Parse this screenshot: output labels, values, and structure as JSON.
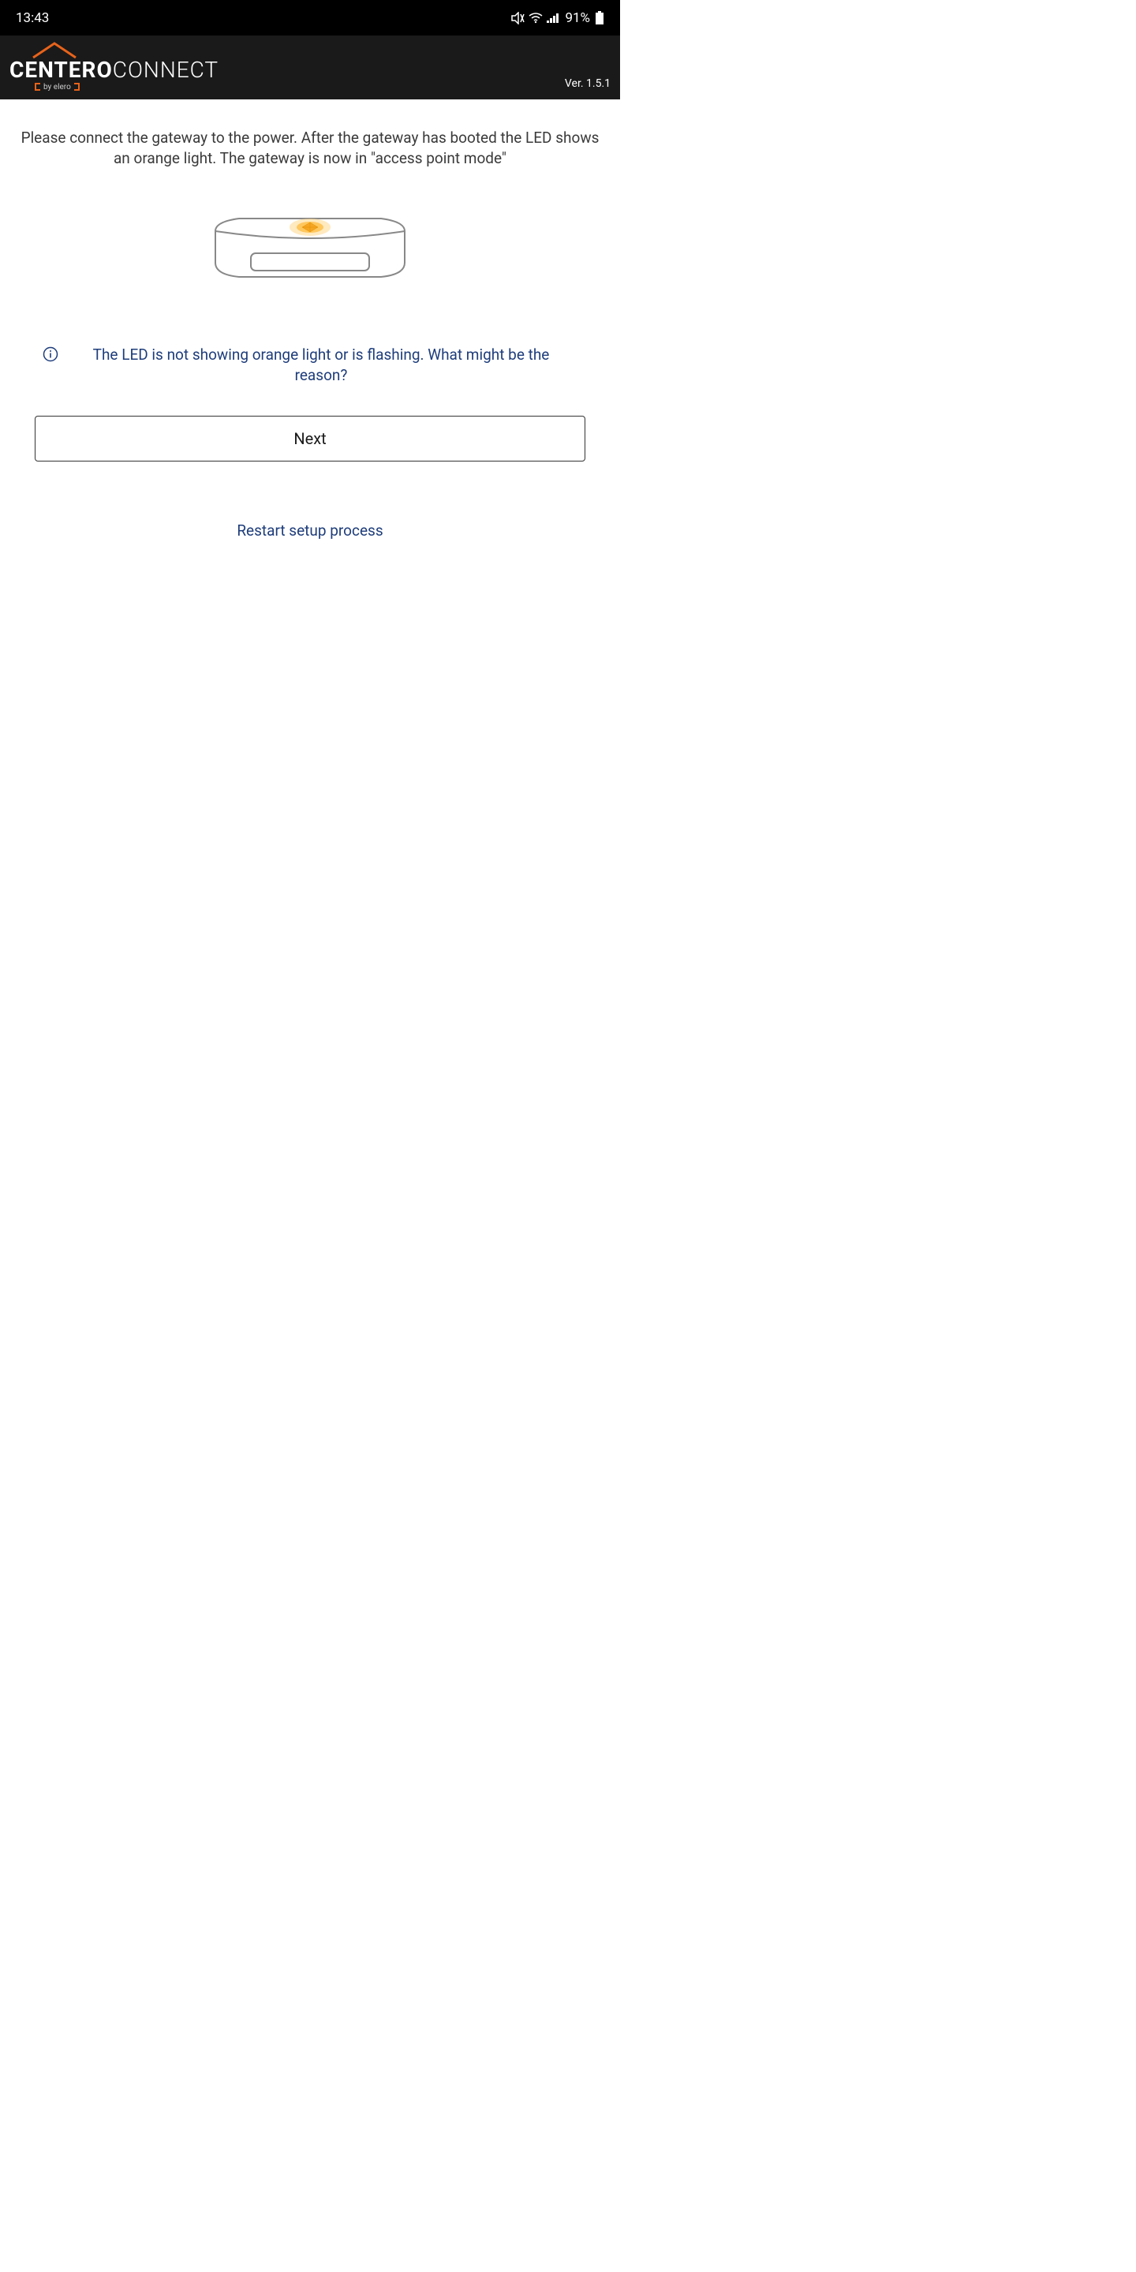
{
  "statusBar": {
    "time": "13:43",
    "battery": "91%"
  },
  "header": {
    "logoBold": "CENTERO",
    "logoLight": "CONNECT",
    "logoSub": "by elero",
    "version": "Ver. 1.5.1"
  },
  "content": {
    "instruction": "Please connect the gateway to the power. After the gateway has booted the LED shows an orange light. The gateway is now in \"access point mode\"",
    "helpLink": "The LED is not showing orange light or is flashing. What might be the reason?",
    "nextButton": "Next",
    "restartLink": "Restart setup process"
  }
}
